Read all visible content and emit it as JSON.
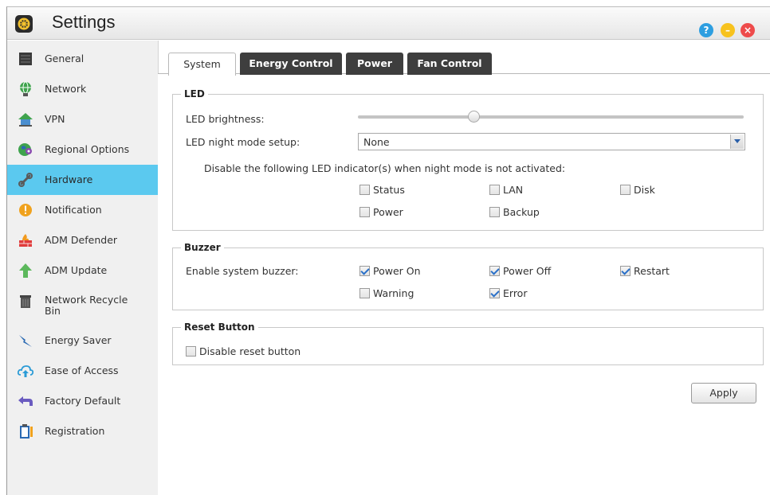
{
  "window": {
    "title": "Settings"
  },
  "titlebar_buttons": {
    "help": "?",
    "minimize": "–",
    "close": "×"
  },
  "sidebar": {
    "items": [
      {
        "label": "General",
        "icon": "server-icon"
      },
      {
        "label": "Network",
        "icon": "globe-network-icon"
      },
      {
        "label": "VPN",
        "icon": "vpn-house-icon"
      },
      {
        "label": "Regional Options",
        "icon": "globe-location-icon"
      },
      {
        "label": "Hardware",
        "icon": "hardware-wrench-icon",
        "active": true
      },
      {
        "label": "Notification",
        "icon": "alert-icon"
      },
      {
        "label": "ADM Defender",
        "icon": "firewall-icon"
      },
      {
        "label": "ADM Update",
        "icon": "update-arrow-icon"
      },
      {
        "label": "Network Recycle Bin",
        "icon": "trash-icon"
      },
      {
        "label": "Energy Saver",
        "icon": "lightning-icon"
      },
      {
        "label": "Ease of Access",
        "icon": "cloud-upload-icon"
      },
      {
        "label": "Factory Default",
        "icon": "undo-arrow-icon"
      },
      {
        "label": "Registration",
        "icon": "clipboard-icon"
      }
    ]
  },
  "tabs": [
    {
      "label": "System",
      "active": true
    },
    {
      "label": "Energy Control",
      "active": false
    },
    {
      "label": "Power",
      "active": false
    },
    {
      "label": "Fan Control",
      "active": false
    }
  ],
  "led": {
    "legend": "LED",
    "brightness_label": "LED brightness:",
    "brightness_level": 0.3,
    "night_mode_label": "LED night mode setup:",
    "night_mode_value": "None",
    "disable_text": "Disable the following LED indicator(s) when night mode is not activated:",
    "indicators": [
      {
        "label": "Status",
        "checked": false
      },
      {
        "label": "LAN",
        "checked": false
      },
      {
        "label": "Disk",
        "checked": false
      },
      {
        "label": "Power",
        "checked": false
      },
      {
        "label": "Backup",
        "checked": false
      }
    ]
  },
  "buzzer": {
    "legend": "Buzzer",
    "enable_label": "Enable system buzzer:",
    "options": [
      {
        "label": "Power On",
        "checked": true
      },
      {
        "label": "Power Off",
        "checked": true
      },
      {
        "label": "Restart",
        "checked": true
      },
      {
        "label": "Warning",
        "checked": false
      },
      {
        "label": "Error",
        "checked": true
      }
    ]
  },
  "reset": {
    "legend": "Reset Button",
    "option": {
      "label": "Disable reset button",
      "checked": false
    }
  },
  "apply_label": "Apply",
  "colors": {
    "accent": "#5bc9ef",
    "tab_dark": "#3e3e3e",
    "check": "#2a70c8"
  }
}
